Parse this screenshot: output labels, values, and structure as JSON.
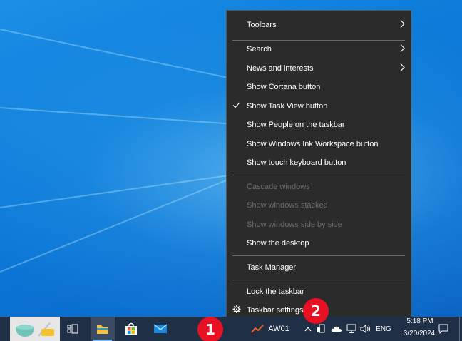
{
  "menu": {
    "items": [
      {
        "label": "Toolbars",
        "submenu": true,
        "enabled": true
      },
      {
        "label": "Search",
        "submenu": true,
        "enabled": true
      },
      {
        "label": "News and interests",
        "submenu": true,
        "enabled": true
      },
      {
        "label": "Show Cortana button",
        "enabled": true
      },
      {
        "label": "Show Task View button",
        "checked": true,
        "enabled": true
      },
      {
        "label": "Show People on the taskbar",
        "enabled": true
      },
      {
        "label": "Show Windows Ink Workspace button",
        "enabled": true
      },
      {
        "label": "Show touch keyboard button",
        "enabled": true
      },
      {
        "label": "Cascade windows",
        "enabled": false
      },
      {
        "label": "Show windows stacked",
        "enabled": false
      },
      {
        "label": "Show windows side by side",
        "enabled": false
      },
      {
        "label": "Show the desktop",
        "enabled": true
      },
      {
        "label": "Task Manager",
        "enabled": true
      },
      {
        "label": "Lock the taskbar",
        "enabled": true
      },
      {
        "label": "Taskbar settings",
        "icon": "gear-icon",
        "enabled": true
      }
    ]
  },
  "taskbar": {
    "apps": [
      "task-view-icon",
      "file-explorer-icon",
      "microsoft-store-icon",
      "mail-icon"
    ],
    "weather_label": "AW01",
    "tray": {
      "language": "ENG",
      "time": "5:18 PM",
      "date": "3/20/2024"
    }
  },
  "badges": {
    "one": "1",
    "two": "2"
  },
  "colors": {
    "menu_bg": "#2b2b2b",
    "taskbar_bg": "#1f2f45",
    "badge": "#e81123",
    "desktop": "#0a78d7"
  }
}
